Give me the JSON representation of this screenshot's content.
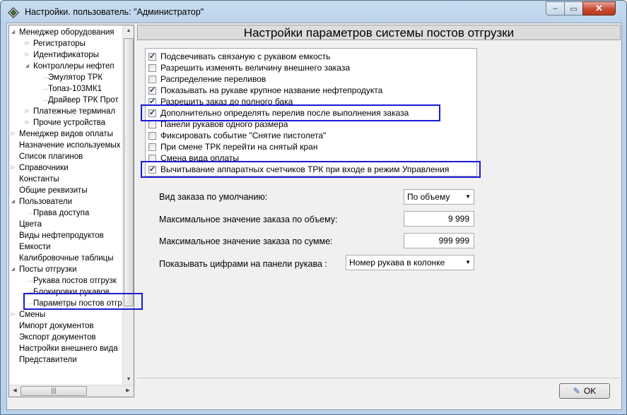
{
  "window": {
    "title": "Настройки. пользователь: \"Администратор\""
  },
  "title_buttons": {
    "minimize": "‒",
    "maximize": "▭",
    "close": "✕"
  },
  "tree": {
    "items": [
      {
        "label": "Менеджер оборудования",
        "level": 1,
        "arrow": "open"
      },
      {
        "label": "Регистраторы",
        "level": 2,
        "arrow": "closed"
      },
      {
        "label": "Идентификаторы",
        "level": 2,
        "arrow": "closed"
      },
      {
        "label": "Контроллеры нефтеп",
        "level": 2,
        "arrow": "open"
      },
      {
        "label": "Эмулятор ТРК",
        "level": 3,
        "arrow": "none"
      },
      {
        "label": "Топаз-103МК1",
        "level": 3,
        "arrow": "none"
      },
      {
        "label": "Драйвер ТРК Прот",
        "level": 3,
        "arrow": "none"
      },
      {
        "label": "Платежные терминал",
        "level": 2,
        "arrow": "closed"
      },
      {
        "label": "Прочие устройства",
        "level": 2,
        "arrow": "closed"
      },
      {
        "label": "Менеджер видов оплаты",
        "level": 1,
        "arrow": "closed"
      },
      {
        "label": "Назначение используемых",
        "level": 1,
        "arrow": "none"
      },
      {
        "label": "Список плагинов",
        "level": 1,
        "arrow": "none"
      },
      {
        "label": "Справочники",
        "level": 1,
        "arrow": "closed"
      },
      {
        "label": "Константы",
        "level": 1,
        "arrow": "none"
      },
      {
        "label": "Общие реквизиты",
        "level": 1,
        "arrow": "none"
      },
      {
        "label": "Пользователи",
        "level": 1,
        "arrow": "open"
      },
      {
        "label": "Права доступа",
        "level": 2,
        "arrow": "none"
      },
      {
        "label": "Цвета",
        "level": 1,
        "arrow": "none"
      },
      {
        "label": "Виды нефтепродуктов",
        "level": 1,
        "arrow": "none"
      },
      {
        "label": "Емкости",
        "level": 1,
        "arrow": "none"
      },
      {
        "label": "Калибровочные таблицы",
        "level": 1,
        "arrow": "none"
      },
      {
        "label": "Посты отгрузки",
        "level": 1,
        "arrow": "open"
      },
      {
        "label": "Рукава постов отгрузк",
        "level": 2,
        "arrow": "none"
      },
      {
        "label": "Блокировки рукавов",
        "level": 2,
        "arrow": "none"
      },
      {
        "label": "Параметры постов отгр",
        "level": 2,
        "arrow": "none"
      },
      {
        "label": "Смены",
        "level": 1,
        "arrow": "closed"
      },
      {
        "label": "Импорт документов",
        "level": 1,
        "arrow": "none"
      },
      {
        "label": "Экспорт документов",
        "level": 1,
        "arrow": "none"
      },
      {
        "label": "Настройки внешнего вида",
        "level": 1,
        "arrow": "none"
      },
      {
        "label": "Представители",
        "level": 1,
        "arrow": "none"
      }
    ]
  },
  "main": {
    "heading": "Настройки параметров системы постов отгрузки",
    "checkboxes": [
      {
        "label": "Подсвечивать связаную с рукавом емкость",
        "checked": true
      },
      {
        "label": "Разрешить изменять величину внешнего заказа",
        "checked": false
      },
      {
        "label": "Распределение переливов",
        "checked": false
      },
      {
        "label": "Показывать на рукаве крупное название нефтепродукта",
        "checked": true
      },
      {
        "label": "Разрешить заказ до полного бака",
        "checked": true
      },
      {
        "label": "Дополнительно определять перелив после выполнения заказа",
        "checked": true
      },
      {
        "label": "Панели рукавов одного размера",
        "checked": false
      },
      {
        "label": "Фиксировать событие \"Снятие пистолета\"",
        "checked": false
      },
      {
        "label": "При смене ТРК перейти на снятый кран",
        "checked": false
      },
      {
        "label": "Смена вида оплаты",
        "checked": false
      },
      {
        "label": "Вычитывание аппаратных счетчиков ТРК при входе в режим Управления",
        "checked": true
      }
    ],
    "fields": {
      "order_type_label": "Вид заказа по умолчанию:",
      "order_type_value": "По объему",
      "max_volume_label": "Максимальное значение заказа по объему:",
      "max_volume_value": "9 999",
      "max_sum_label": "Максимальное значение заказа по сумме:",
      "max_sum_value": "999 999",
      "panel_digits_label": "Показывать цифрами на панели рукава :",
      "panel_digits_value": "Номер рукава в колонке"
    }
  },
  "footer": {
    "ok_label": "OK"
  }
}
